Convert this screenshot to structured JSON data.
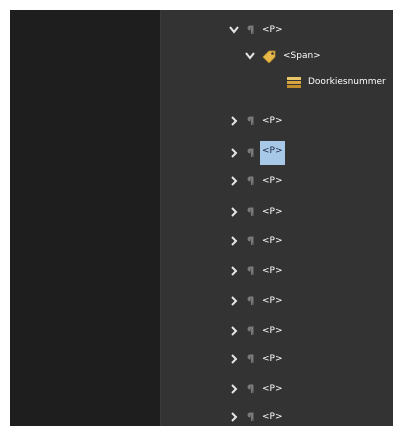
{
  "tree": {
    "nodes": [
      {
        "label": "<P>",
        "chevron": "down",
        "icon": "paragraph-icon",
        "selected": false
      },
      {
        "label": "<Span>",
        "chevron": "down",
        "icon": "tag-icon",
        "selected": false
      },
      {
        "label": "Doorkiesnummer",
        "chevron": "none",
        "icon": "structure-element-icon",
        "selected": false
      },
      {
        "label": "<P>",
        "chevron": "right",
        "icon": "paragraph-icon",
        "selected": false
      },
      {
        "label": "<P>",
        "chevron": "right",
        "icon": "paragraph-icon",
        "selected": true
      },
      {
        "label": "<P>",
        "chevron": "right",
        "icon": "paragraph-icon",
        "selected": false
      },
      {
        "label": "<P>",
        "chevron": "right",
        "icon": "paragraph-icon",
        "selected": false
      },
      {
        "label": "<P>",
        "chevron": "right",
        "icon": "paragraph-icon",
        "selected": false
      },
      {
        "label": "<P>",
        "chevron": "right",
        "icon": "paragraph-icon",
        "selected": false
      },
      {
        "label": "<P>",
        "chevron": "right",
        "icon": "paragraph-icon",
        "selected": false
      },
      {
        "label": "<P>",
        "chevron": "right",
        "icon": "paragraph-icon",
        "selected": false
      },
      {
        "label": "<P>",
        "chevron": "right",
        "icon": "paragraph-icon",
        "selected": false
      },
      {
        "label": "<P>",
        "chevron": "right",
        "icon": "paragraph-icon",
        "selected": false
      },
      {
        "label": "<P>",
        "chevron": "right",
        "icon": "paragraph-icon",
        "selected": false
      }
    ]
  },
  "colors": {
    "background": "#333333",
    "left_pane": "#1e1e1e",
    "selection": "#a8c8e8",
    "text": "#ffffff"
  }
}
